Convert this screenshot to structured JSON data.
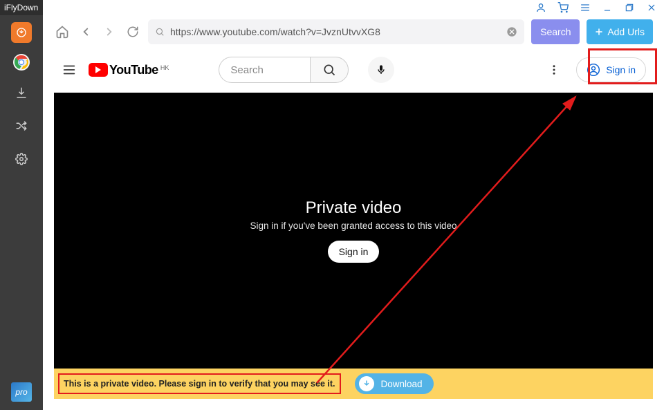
{
  "app": {
    "title": "iFlyDown",
    "pro_label": "pro"
  },
  "browser": {
    "url": "https://www.youtube.com/watch?v=JvznUtvvXG8",
    "search_label": "Search",
    "add_urls_label": "Add Urls"
  },
  "youtube": {
    "brand": "YouTube",
    "region": "HK",
    "search_placeholder": "Search",
    "signin_label": "Sign in"
  },
  "player": {
    "title": "Private video",
    "subtitle": "Sign in if you've been granted access to this video",
    "signin_label": "Sign in"
  },
  "status": {
    "message": "This is a private video. Please sign in to verify that you may see it.",
    "download_label": "Download"
  }
}
